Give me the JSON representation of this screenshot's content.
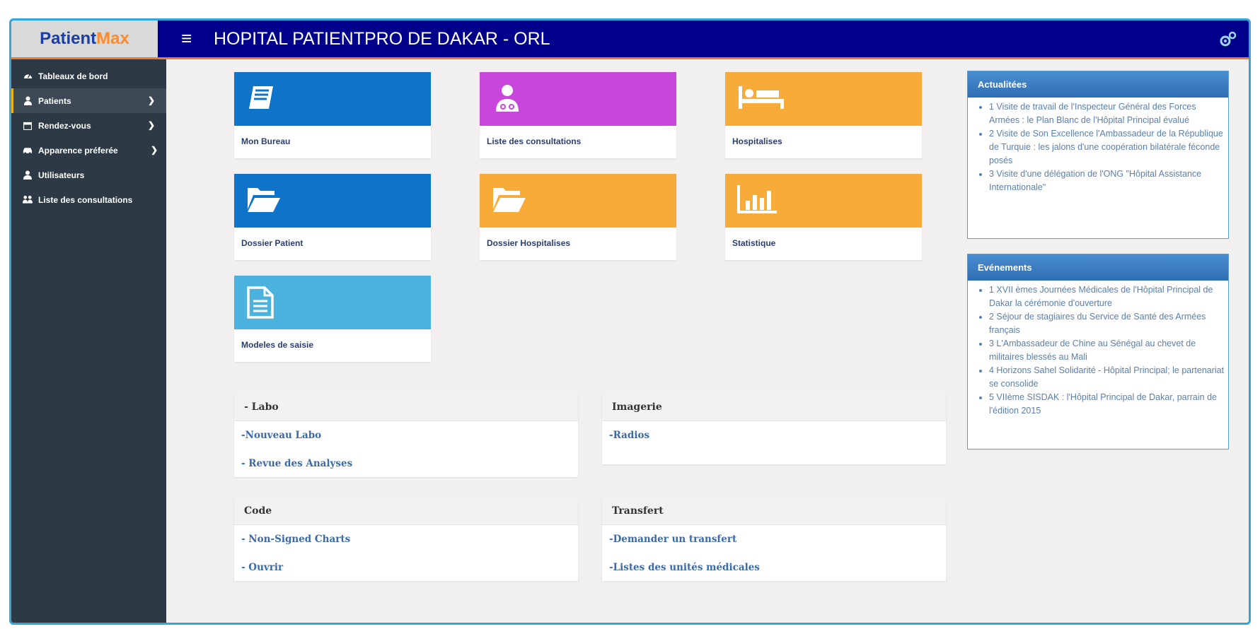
{
  "brand": {
    "part1": "Patient",
    "part2": "Max"
  },
  "header": {
    "menu_icon": "≡",
    "title": "HOPITAL PATIENTPRO DE DAKAR - ORL"
  },
  "sidebar": {
    "items": [
      {
        "label": "Tableaux de bord",
        "icon": "dashboard-icon"
      },
      {
        "label": "Patients",
        "icon": "user-patient-icon"
      },
      {
        "label": "Rendez-vous",
        "icon": "calendar-icon"
      },
      {
        "label": "Apparence préferée",
        "icon": "car-icon"
      },
      {
        "label": "Utilisateurs",
        "icon": "user-icon"
      },
      {
        "label": "Liste des consultations",
        "icon": "users-icon"
      }
    ]
  },
  "tiles": [
    {
      "label": "Mon Bureau",
      "icon": "book-icon",
      "color": "#0e74c9"
    },
    {
      "label": "Liste des consultations",
      "icon": "doctor-icon",
      "color": "#c946dd"
    },
    {
      "label": "Hospitalises",
      "icon": "bed-icon",
      "color": "#f7ac39"
    },
    {
      "label": "Dossier Patient",
      "icon": "folder-open-icon",
      "color": "#0e74c9"
    },
    {
      "label": "Dossier Hospitalises",
      "icon": "folder-open-icon",
      "color": "#f7ac39"
    },
    {
      "label": "Statistique",
      "icon": "bar-chart-icon",
      "color": "#f7ac39"
    },
    {
      "label": "Modeles de saisie",
      "icon": "document-icon",
      "color": "#4ab2dc"
    }
  ],
  "panels": {
    "labo": {
      "title": "- Labo",
      "links": [
        "-Nouveau Labo",
        "- Revue des Analyses"
      ]
    },
    "imagerie": {
      "title": "Imagerie",
      "links": [
        "-Radios"
      ]
    },
    "code": {
      "title": "Code",
      "links": [
        "- Non-Signed Charts",
        "- Ouvrir"
      ]
    },
    "transfert": {
      "title": "Transfert",
      "links": [
        "-Demander un transfert",
        "-Listes des unités médicales"
      ]
    }
  },
  "actualites": {
    "title": "Actualitées",
    "items": [
      "1 Visite de travail de l'Inspecteur Général des Forces Armées : le Plan Blanc de l'Hôpital Principal évalué",
      "2 Visite de Son Excellence l'Ambassadeur de la République de Turquie : les jalons d'une coopération bilatérale féconde posés",
      "3 Visite d'une délégation de l'ONG \"Hôpital Assistance Internationale\""
    ]
  },
  "evenements": {
    "title": "Evénements",
    "items": [
      "1 XVII èmes Journées Médicales de l'Hôpital Principal de Dakar la cérémonie d'ouverture",
      "2 Séjour de stagiaires du Service de Santé des Armées français",
      "3 L'Ambassadeur de Chine au Sénégal au chevet de militaires blessés au Mali",
      "4 Horizons Sahel Solidarité - Hôpital Principal; le partenariat se consolide",
      "5 VIIème SISDAK : l'Hôpital Principal de Dakar, parrain de l'édition 2015"
    ]
  }
}
